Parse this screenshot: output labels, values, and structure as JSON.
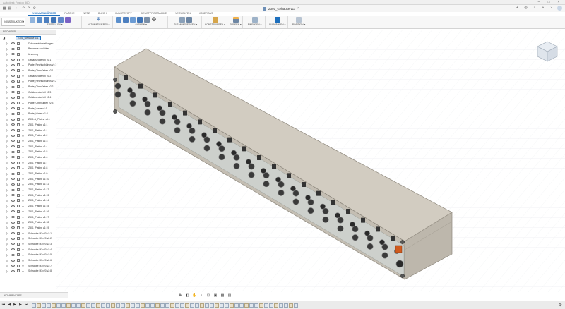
{
  "app": {
    "title": "Autodesk Fusion 360",
    "document_name": "Z301_Gehäuse v11"
  },
  "tabs": [
    {
      "label": "VOLUMENKÖRPER",
      "active": true
    },
    {
      "label": "FLÄCHE",
      "active": false
    },
    {
      "label": "NETZ",
      "active": false
    },
    {
      "label": "BLECH",
      "active": false
    },
    {
      "label": "KUNSTSTOFF",
      "active": false
    },
    {
      "label": "DIENSTPROGRAMME",
      "active": false
    },
    {
      "label": "VERWALTEN",
      "active": false
    },
    {
      "label": "JOBERGAS",
      "active": false
    }
  ],
  "workspace": {
    "label": "KONSTRUKTION"
  },
  "ribbon_groups": [
    {
      "label": "ERSTELLEN ▾"
    },
    {
      "label": "AUTOMATISIEREN ▾"
    },
    {
      "label": "ÄNDERN ▾"
    },
    {
      "label": "ZUSAMMENFÜGEN ▾"
    },
    {
      "label": "KONSTRUIEREN ▾"
    },
    {
      "label": "PRÜFEN ▾"
    },
    {
      "label": "EINFÜGEN ▾"
    },
    {
      "label": "AUSWÄHLEN ▾"
    },
    {
      "label": "POSITION ▾"
    }
  ],
  "browser": {
    "header": "BROWSER",
    "root": "Z301_Gehäuse v11",
    "items": [
      "Dokumenteinstellungen",
      "Benannte Ansichten",
      "Ursprung",
      "Gehäuseoberteil v2:1",
      "Platte_RechtsobLinks v1:1",
      "Platte_Obenlünten v2:1",
      "Gehäuseoberteil v2:2",
      "Platte_RechtsobLinks v1:2",
      "Platte_Obenlünten v2:2",
      "Gehäuseoberteil v2:3",
      "Gehäuseoberteil v2:4",
      "Platte_Obenlünten v2:3",
      "Platte_Vorne v1:1",
      "Platte_Hinten v1:2",
      "Z301-A_Platine v5:1",
      "Z301_Platine v1:1",
      "Z301_Platine v1:1",
      "Z301_Platine v1:2",
      "Z301_Platine v1:3",
      "Z301_Platine v1:4",
      "Z301_Platine v1:5",
      "Z301_Platine v1:6",
      "Z301_Platine v1:7",
      "Z301_Platine v1:8",
      "Z301_Platine v1:9",
      "Z301_Platine v1:10",
      "Z301_Platine v1:11",
      "Z301_Platine v1:12",
      "Z301_Platine v1:13",
      "Z301_Platine v1:14",
      "Z301_Platine v1:15",
      "Z301_Platine v1:16",
      "Z301_Platine v1:17",
      "Z301_Platine v1:18",
      "Z301_Platine v1:19",
      "Schraube M3x20 v2:1",
      "Schraube M3x20 v2:2",
      "Schraube M3x20 v2:3",
      "Schraube M3x20 v2:4",
      "Schraube M3x20 v2:5",
      "Schraube M3x20 v2:6",
      "Schraube M3x20 v2:7",
      "Schraube M3x20 v2:8"
    ]
  },
  "bottom_panel": {
    "label": "KOMMENTARE"
  },
  "viewcube": {
    "icon": "view-cube-icon"
  },
  "colors": {
    "accent": "#1d6fbd",
    "body_top": "#d2ccc1",
    "body_front": "#c4beb3",
    "front_panel": "#cdd0cc",
    "connector": "#3a3a3a",
    "indicator": "#d05a1e"
  }
}
